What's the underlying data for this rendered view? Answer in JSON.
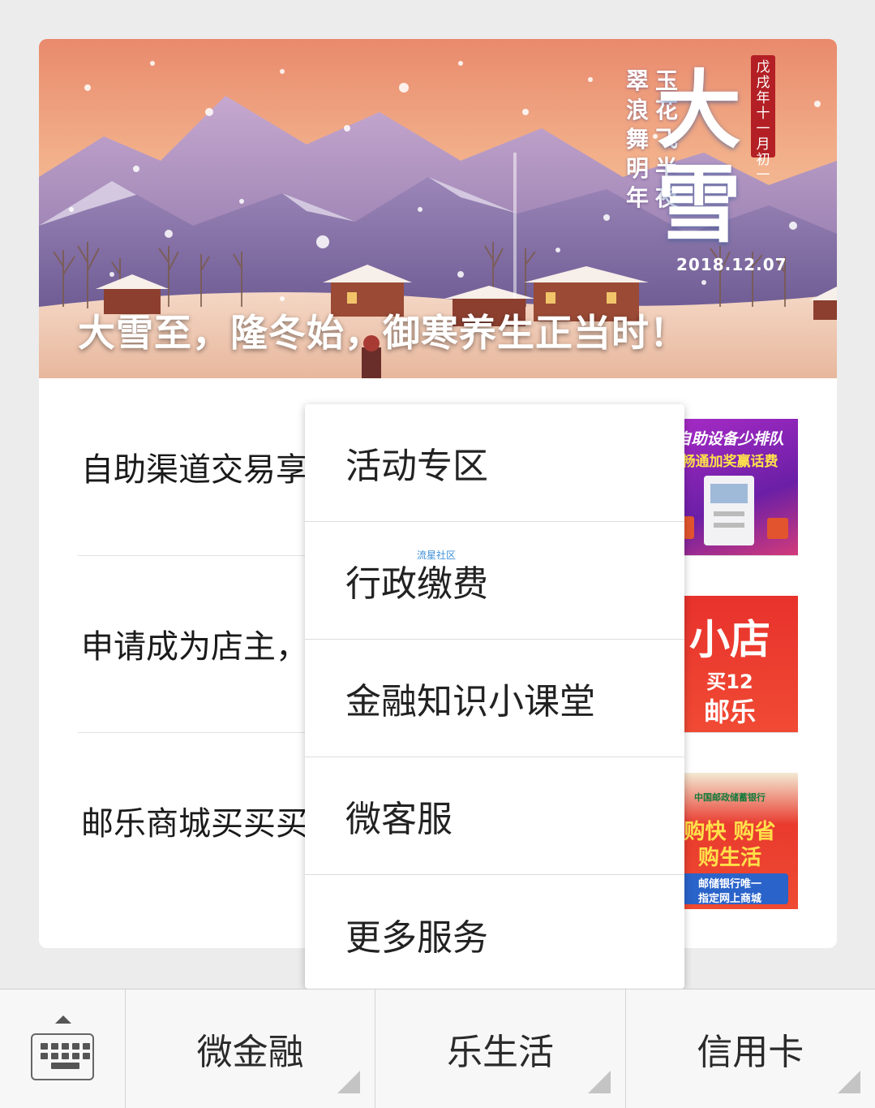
{
  "banner": {
    "title": "大雪至，隆冬始，御寒养生正当时！",
    "poem_col1": [
      "玉",
      "花",
      "飞",
      "半",
      "夜"
    ],
    "poem_col2": [
      "翠",
      "浪",
      "舞",
      "明",
      "年"
    ],
    "big_char_1": "大",
    "big_char_2": "雪",
    "date": "2018.12.07",
    "seal": "戊戌年十一月初一"
  },
  "articles": [
    {
      "title": "自助渠道交易享",
      "thumb_line1": "自助设备少排队",
      "thumb_line2": "畅通加奖赢话费"
    },
    {
      "title": "申请成为店主，",
      "thumb_line1": "小店",
      "thumb_line2": "买12",
      "thumb_line3": "邮乐"
    },
    {
      "title": "邮乐商城买买买",
      "thumb_line0": "中国邮政储蓄银行",
      "thumb_line1": "购快 购省",
      "thumb_line2": "购生活",
      "thumb_line3": "邮储银行唯一",
      "thumb_line4": "指定网上商城"
    }
  ],
  "popup": {
    "items": [
      "活动专区",
      "行政缴费",
      "金融知识小课堂",
      "微客服",
      "更多服务"
    ],
    "watermark": "流星社区"
  },
  "bottom_menu": {
    "items": [
      "微金融",
      "乐生活",
      "信用卡"
    ]
  },
  "icons": {
    "keyboard": "keyboard-icon",
    "caret": "caret-up-icon",
    "submenu": "submenu-corner-icon"
  },
  "colors": {
    "background": "#ececec",
    "card": "#ffffff",
    "seal": "#b31f24",
    "watermark": "#3b8fd9"
  }
}
